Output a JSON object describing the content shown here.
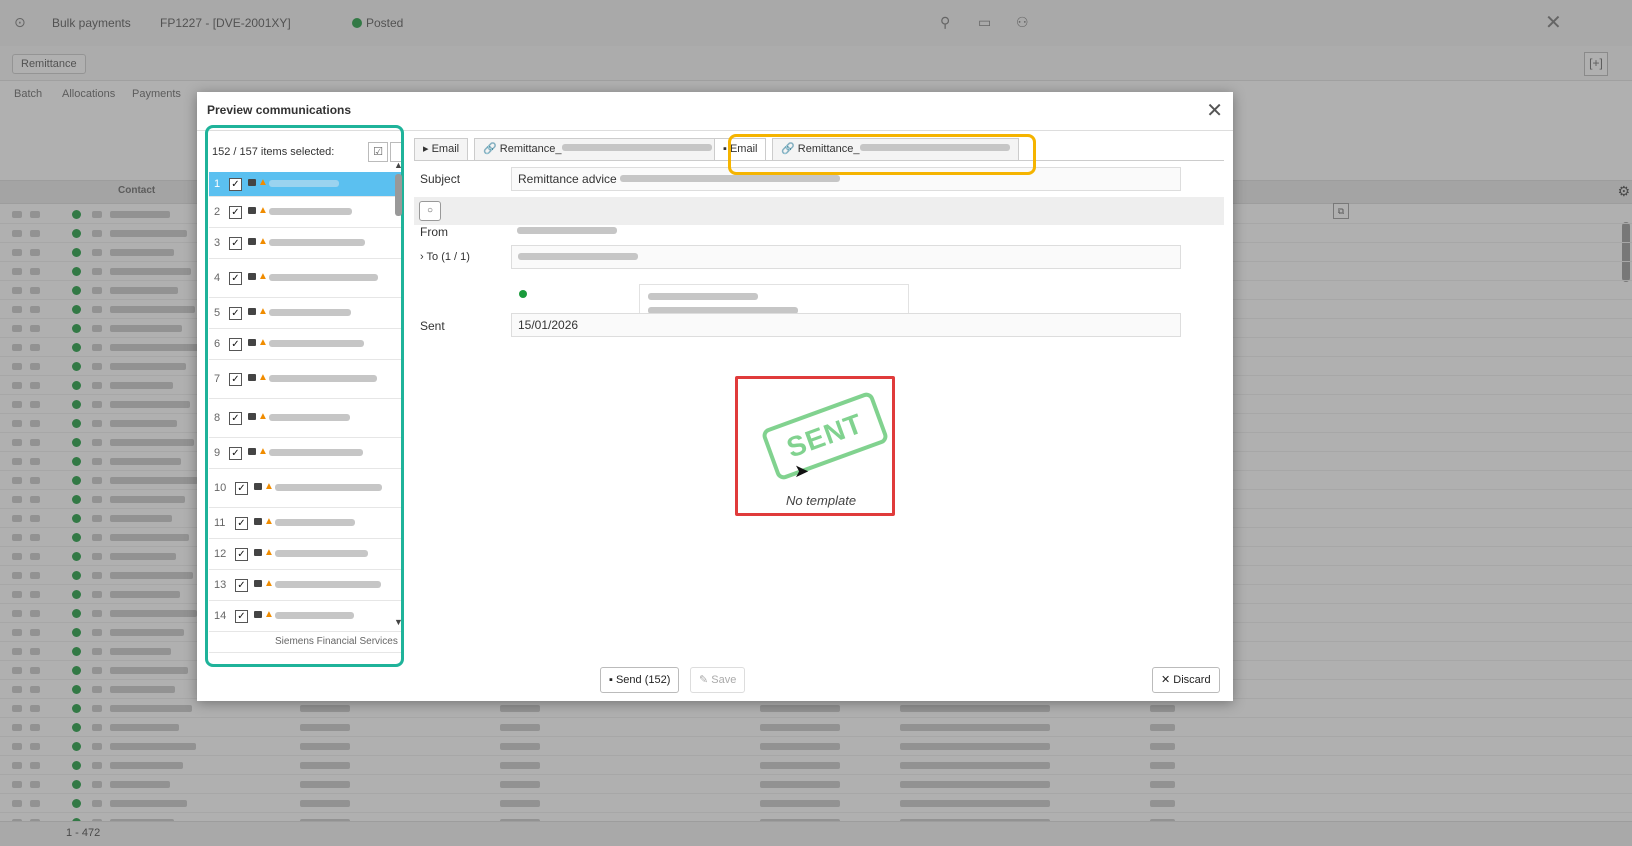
{
  "background": {
    "top_tab": "Bulk payments",
    "top_tab2": "FP1227 - [DVE-2001XY]",
    "status": "Posted",
    "chip": "Remittance",
    "tabs": [
      "Batch",
      "Allocations",
      "Payments"
    ],
    "grid_columns": [
      "Contact"
    ],
    "pager": "1 - 472"
  },
  "modal": {
    "title": "Preview communications",
    "items_selected": "152 / 157 items selected:",
    "items": [
      {
        "num": "1",
        "selected": true
      },
      {
        "num": "2"
      },
      {
        "num": "3"
      },
      {
        "num": "4"
      },
      {
        "num": "5"
      },
      {
        "num": "6"
      },
      {
        "num": "7"
      },
      {
        "num": "8"
      },
      {
        "num": "9"
      },
      {
        "num": "10"
      },
      {
        "num": "11"
      },
      {
        "num": "12"
      },
      {
        "num": "13"
      },
      {
        "num": "14"
      }
    ],
    "partial_item": "Siemens Financial Services",
    "tabs": [
      {
        "label": "Email"
      },
      {
        "label": "Remittance_"
      },
      {
        "label": "Email",
        "active": true
      },
      {
        "label": "Remittance_"
      }
    ],
    "fields": {
      "subject_label": "Subject",
      "subject_value": "Remittance advice",
      "from_label": "From",
      "to_label": "To (1 / 1)",
      "sent_label": "Sent",
      "sent_value": "15/01/2026"
    },
    "stamp_text": "SENT",
    "no_template": "No template",
    "buttons": {
      "send": "Send (152)",
      "save": "Save",
      "discard": "Discard"
    }
  },
  "colors": {
    "highlight_left": "#1fb39a",
    "highlight_tabs": "#f5b400",
    "highlight_stamp": "#e03b3b",
    "stamp": "#4cc061",
    "selected_row": "#5bc0f0"
  }
}
